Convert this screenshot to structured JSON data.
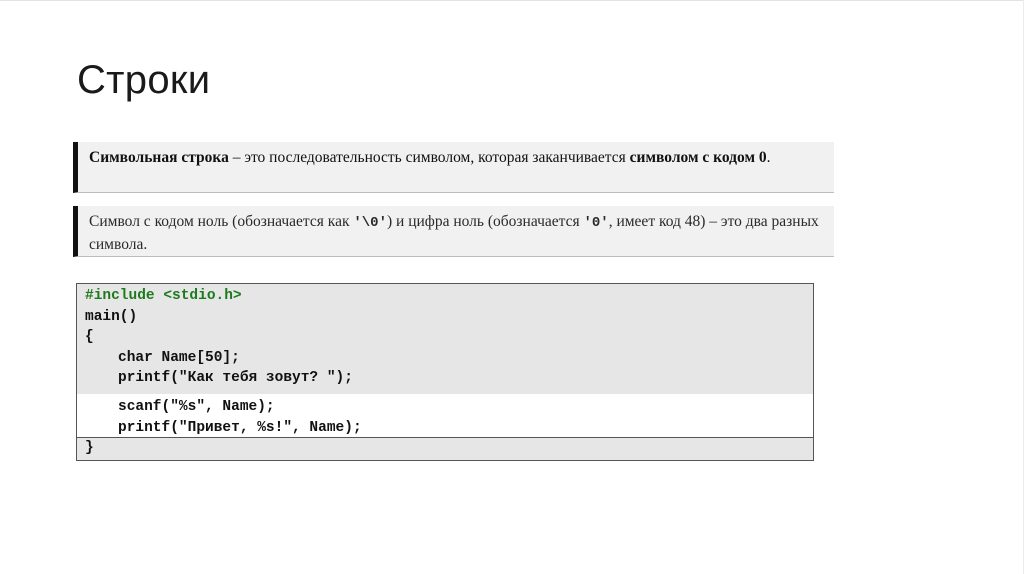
{
  "slide": {
    "title": "Строки"
  },
  "definition": {
    "term": "Символьная строка",
    "dash": " – ",
    "text": "это последовательность символом, которая заканчивается ",
    "bold_end": "символом с кодом 0",
    "period": "."
  },
  "note": {
    "part1": "Символ с кодом ноль (обозначается как ",
    "code1": "'\\0'",
    "part2": ") и цифра ноль (обозначается ",
    "code2": "'0'",
    "part3": ", имеет код 48) – это два разных символа."
  },
  "code": {
    "line1": "#include <stdio.h>",
    "line2": "main()",
    "line3": "{",
    "line4": "char Name[50];",
    "line5": "printf(\"Как тебя зовут? \");",
    "line6": "scanf(\"%s\", Name);",
    "line7": "printf(\"Привет, %s!\", Name);",
    "line8": "}"
  },
  "colors": {
    "include_directive": "#1e7a1e",
    "box_border": "#111111",
    "code_band": "#e6e6e6"
  }
}
